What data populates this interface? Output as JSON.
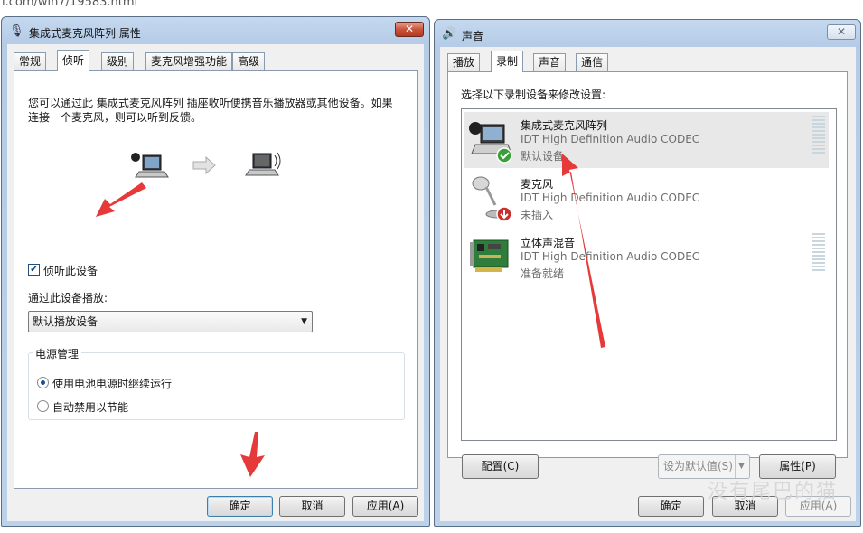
{
  "page": {
    "url_fragment": "l.com/win7/19583.html"
  },
  "properties_window": {
    "title": "集成式麦克风阵列 属性",
    "close_symbol": "✕",
    "tabs": [
      {
        "label": "常规"
      },
      {
        "label": "侦听"
      },
      {
        "label": "级别"
      },
      {
        "label": "麦克风增强功能"
      },
      {
        "label": "高级"
      }
    ],
    "active_tab": "侦听",
    "description": "您可以通过此 集成式麦克风阵列 插座收听便携音乐播放器或其他设备。如果连接一个麦克风，则可以听到反馈。",
    "listen_checkbox_label": "侦听此设备",
    "listen_checked": true,
    "playback_label": "通过此设备播放:",
    "playback_device": "默认播放设备",
    "power_group_label": "电源管理",
    "power_options": [
      {
        "label": "使用电池电源时继续运行",
        "selected": true
      },
      {
        "label": "自动禁用以节能",
        "selected": false
      }
    ],
    "buttons": {
      "ok": "确定",
      "cancel": "取消",
      "apply": "应用(A)"
    }
  },
  "sound_window": {
    "title": "声音",
    "close_symbol": "✕",
    "tabs": [
      {
        "label": "播放"
      },
      {
        "label": "录制"
      },
      {
        "label": "声音"
      },
      {
        "label": "通信"
      }
    ],
    "active_tab": "录制",
    "instruction": "选择以下录制设备来修改设置:",
    "devices": [
      {
        "name": "集成式麦克风阵列",
        "description": "IDT High Definition Audio CODEC",
        "status": "默认设备",
        "icon": "laptop-mic-icon",
        "selected": true
      },
      {
        "name": "麦克风",
        "description": "IDT High Definition Audio CODEC",
        "status": "未插入",
        "icon": "microphone-icon",
        "selected": false
      },
      {
        "name": "立体声混音",
        "description": "IDT High Definition Audio CODEC",
        "status": "准备就绪",
        "icon": "sound-card-icon",
        "selected": false
      }
    ],
    "buttons": {
      "configure": "配置(C)",
      "set_default": "设为默认值(S)",
      "properties": "属性(P)",
      "ok": "确定",
      "cancel": "取消",
      "apply": "应用(A)"
    }
  },
  "watermark": "没有尾巴的猫",
  "colors": {
    "annotation_arrow": "#e5393a",
    "titlebar": "#bcd1ea",
    "close_button": "#c9543b",
    "selected_row": "#e8e8e8"
  }
}
